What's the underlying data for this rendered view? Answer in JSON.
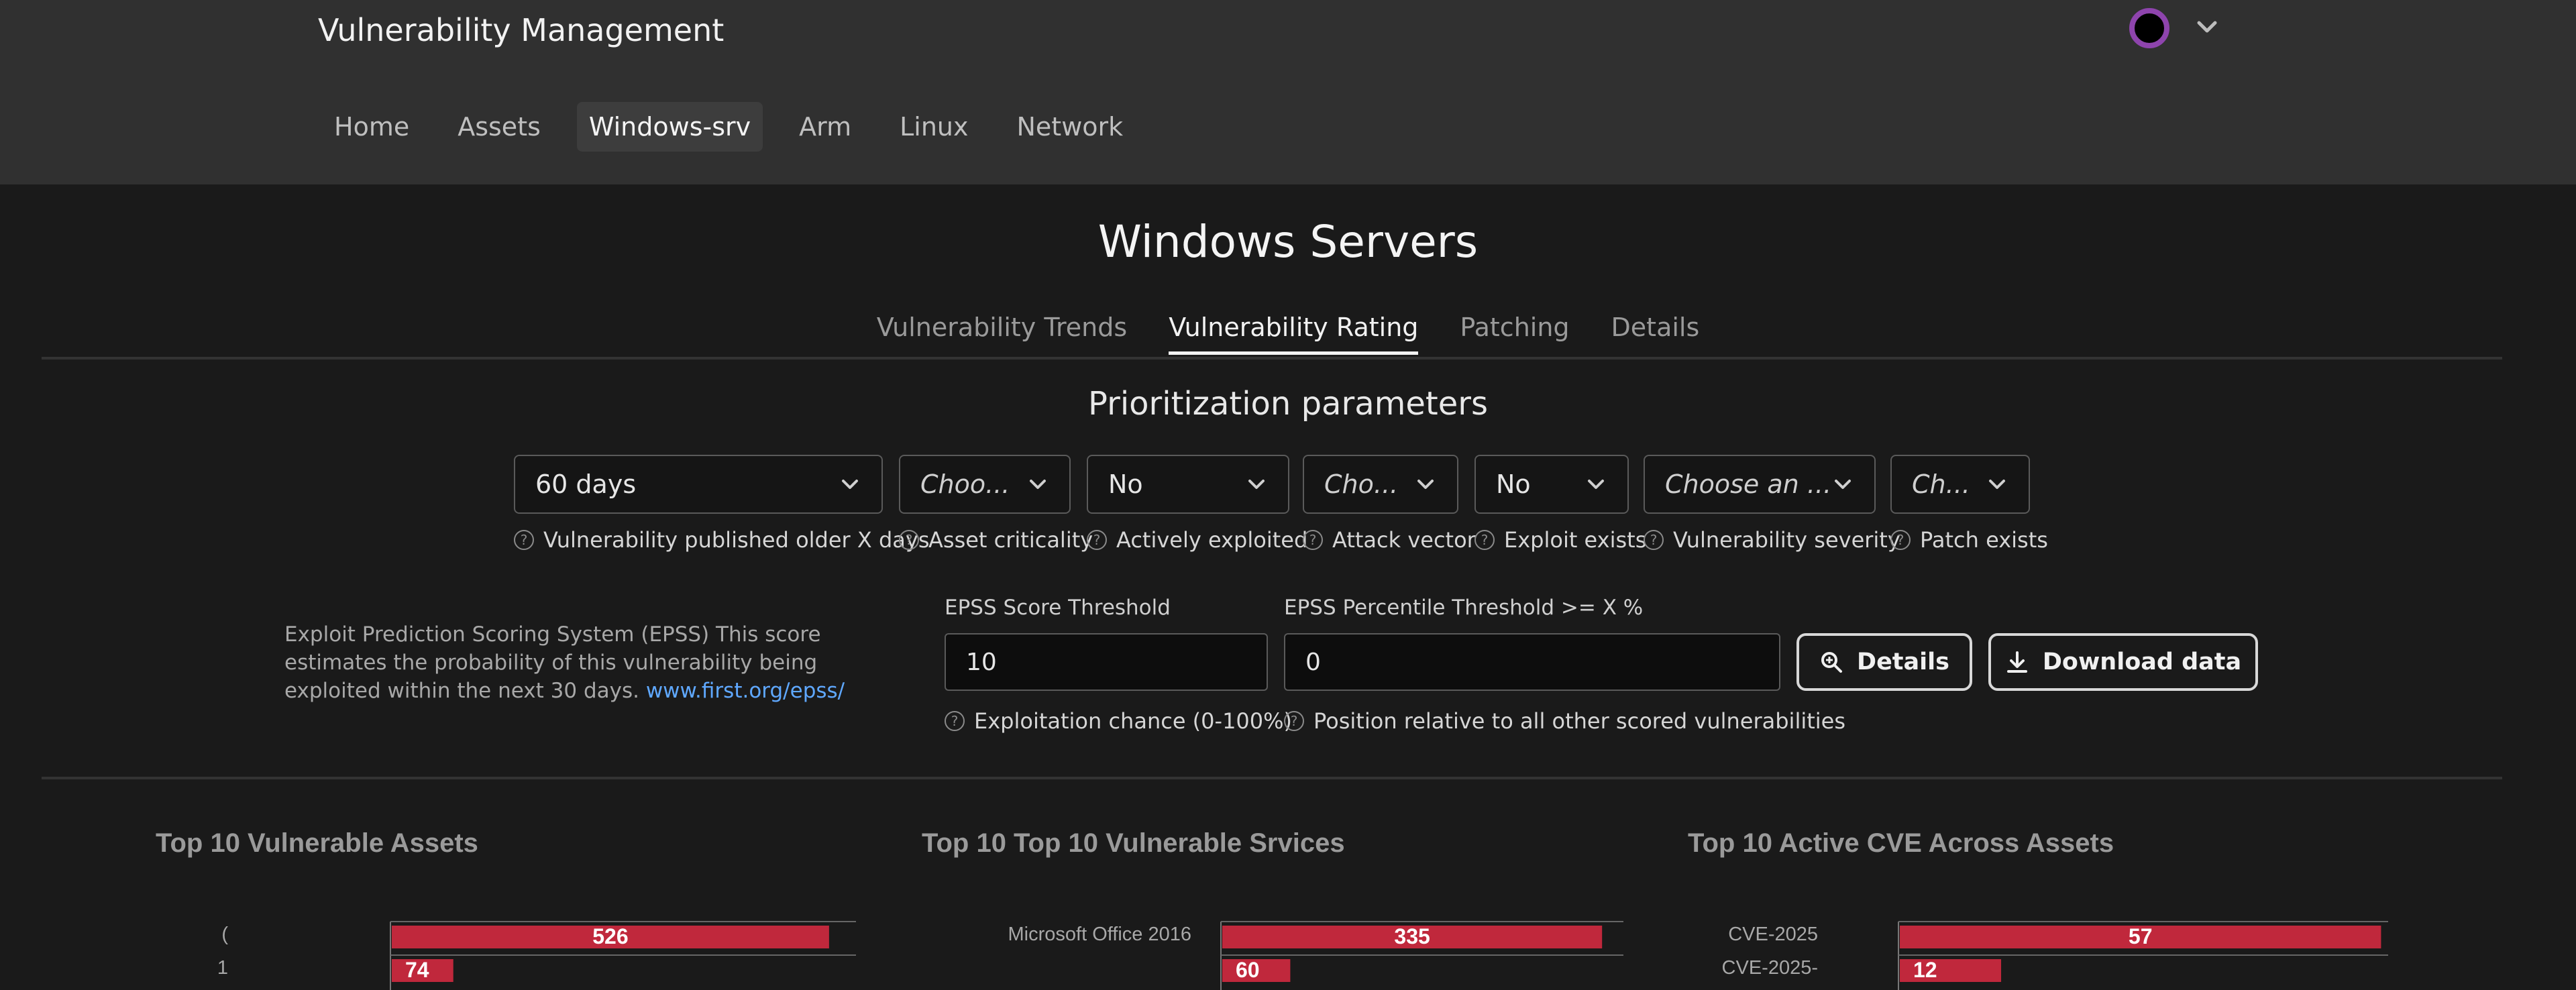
{
  "app": {
    "title": "Vulnerability Management",
    "avatar_color": "#8e44ad"
  },
  "nav": {
    "items": [
      {
        "label": "Home",
        "active": false
      },
      {
        "label": "Assets",
        "active": false
      },
      {
        "label": "Windows-srv",
        "active": true
      },
      {
        "label": "Arm",
        "active": false
      },
      {
        "label": "Linux",
        "active": false
      },
      {
        "label": "Network",
        "active": false
      }
    ]
  },
  "page": {
    "title": "Windows Servers",
    "tabs": [
      {
        "label": "Vulnerability Trends",
        "active": false
      },
      {
        "label": "Vulnerability Rating",
        "active": true
      },
      {
        "label": "Patching",
        "active": false
      },
      {
        "label": "Details",
        "active": false
      }
    ]
  },
  "params": {
    "title": "Prioritization parameters",
    "filters": [
      {
        "value": "60 days",
        "placeholder": false,
        "hint": "Vulnerability published older X days"
      },
      {
        "value": "Choo...",
        "placeholder": true,
        "hint": "Asset criticality"
      },
      {
        "value": "No",
        "placeholder": false,
        "hint": "Actively exploited"
      },
      {
        "value": "Cho...",
        "placeholder": true,
        "hint": "Attack vector"
      },
      {
        "value": "No",
        "placeholder": false,
        "hint": "Exploit exists"
      },
      {
        "value": "Choose an ...",
        "placeholder": true,
        "hint": "Vulnerability severity"
      },
      {
        "value": "Ch...",
        "placeholder": true,
        "hint": "Patch exists"
      }
    ]
  },
  "epss": {
    "description": "Exploit Prediction Scoring System (EPSS) This score estimates the probability of this vulnerability being exploited within the next 30 days.",
    "link": "www.first.org/epss/",
    "score_label": "EPSS Score Threshold",
    "score_value": "10",
    "score_hint": "Exploitation chance (0-100%)",
    "percentile_label": "EPSS Percentile Threshold >= X %",
    "percentile_value": "0",
    "percentile_hint": "Position relative to all other scored vulnerabilities",
    "details_button": "Details",
    "download_button": "Download data"
  },
  "charts": {
    "bar_color": "#c0283c"
  },
  "chart_data": [
    {
      "type": "bar",
      "title": "Top 10 Vulnerable Assets",
      "categories": [
        "(",
        "1"
      ],
      "values": [
        526,
        74
      ],
      "xlim": [
        0,
        560
      ]
    },
    {
      "type": "bar",
      "title": "Top 10 Top 10 Vulnerable Srvices",
      "categories": [
        "Microsoft Office 2016",
        ""
      ],
      "values": [
        335,
        60
      ],
      "xlim": [
        0,
        355
      ]
    },
    {
      "type": "bar",
      "title": "Top 10 Active CVE Across Assets",
      "categories": [
        "CVE-2025",
        "CVE-2025-"
      ],
      "values": [
        57,
        12
      ],
      "xlim": [
        0,
        58
      ]
    }
  ]
}
